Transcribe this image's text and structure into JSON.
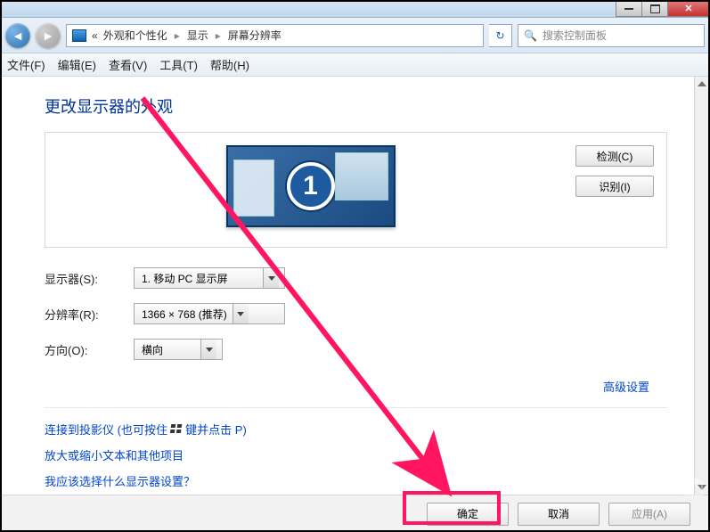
{
  "breadcrumb": {
    "prefix": "«",
    "item1": "外观和个性化",
    "item2": "显示",
    "item3": "屏幕分辨率"
  },
  "search": {
    "placeholder": "搜索控制面板"
  },
  "menu": {
    "file": "文件(F)",
    "edit": "编辑(E)",
    "view": "查看(V)",
    "tools": "工具(T)",
    "help": "帮助(H)"
  },
  "heading": "更改显示器的外观",
  "monitor_number": "1",
  "buttons": {
    "detect": "检测(C)",
    "identify": "识别(I)",
    "ok": "确定",
    "cancel": "取消",
    "apply": "应用(A)"
  },
  "form": {
    "display_label": "显示器(S):",
    "display_value": "1. 移动 PC 显示屏",
    "resolution_label": "分辨率(R):",
    "resolution_value": "1366 × 768 (推荐)",
    "orientation_label": "方向(O):",
    "orientation_value": "横向"
  },
  "advanced_link": "高级设置",
  "links": {
    "projector_pre": "连接到投影仪 (也可按住 ",
    "projector_post": " 键并点击 P)",
    "zoom": "放大或缩小文本和其他项目",
    "which": "我应该选择什么显示器设置？"
  }
}
